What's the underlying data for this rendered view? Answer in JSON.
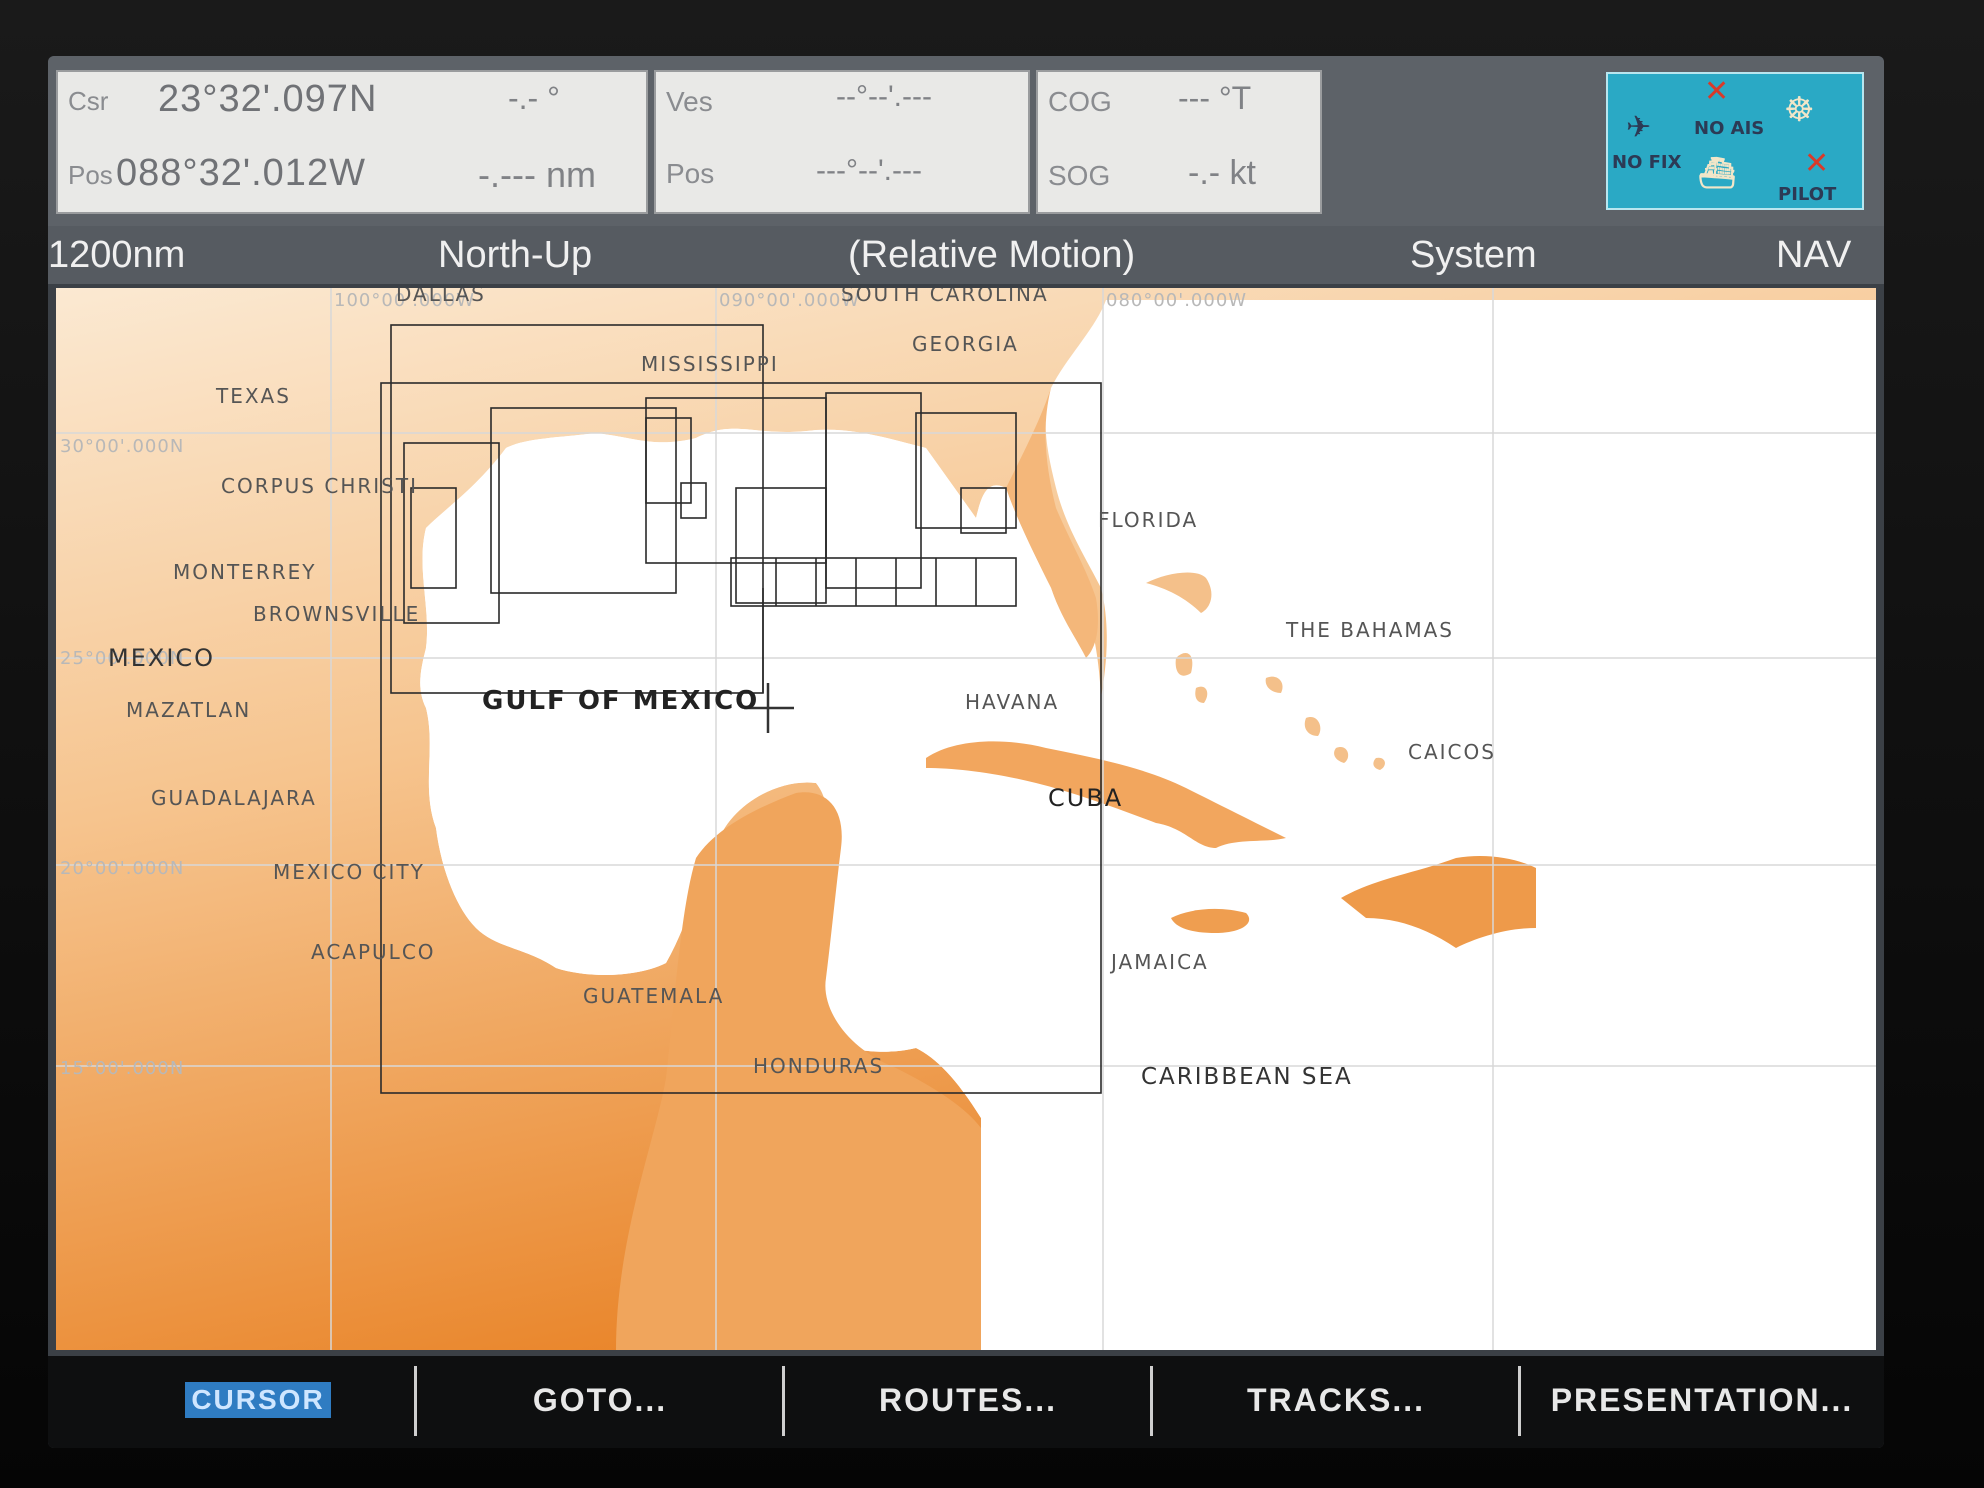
{
  "data_boxes": {
    "box1": {
      "csr_label": "Csr",
      "lat": "23°32'.097N",
      "csr_value": "-.- °",
      "pos_label": "Pos",
      "lon": "088°32'.012W",
      "dist_value": "-.--- nm"
    },
    "box2": {
      "ves_label": "Ves",
      "ves_value": "--°--'.---",
      "pos_label": "Pos",
      "pos_value": "---°--'.---"
    },
    "box3": {
      "cog_label": "COG",
      "cog_value": "--- °T",
      "sog_label": "SOG",
      "sog_value": "-.- kt"
    }
  },
  "status_panel": {
    "no_ais": "NO AIS",
    "no_fix": "NO FIX",
    "pilot": "PILOT"
  },
  "mode_bar": {
    "range": "1200nm",
    "orientation": "North-Up",
    "motion": "(Relative Motion)",
    "menu": "System",
    "mode": "NAV"
  },
  "map": {
    "grid_labels": {
      "lon_100": "100°00'.000W",
      "lon_090": "090°00'.000W",
      "lon_080": "080°00'.000W",
      "lat_30": "30°00'.000N",
      "lat_25": "25°00'.000N",
      "lat_20": "20°00'.000N",
      "lat_15": "15°00'.000N"
    },
    "places": {
      "dallas": "DALLAS",
      "south_carolina": "SOUTH CAROLINA",
      "georgia": "GEORGIA",
      "mississippi": "MISSISSIPPI",
      "texas": "TEXAS",
      "corpus_christi": "CORPUS CHRISTI",
      "monterrey": "MONTERREY",
      "brownsville": "BROWNSVILLE",
      "mexico": "MEXICO",
      "mazatlan": "MAZATLAN",
      "guadalajara": "GUADALAJARA",
      "mexico_city": "MEXICO CITY",
      "acapulco": "ACAPULCO",
      "guatemala": "GUATEMALA",
      "honduras": "HONDURAS",
      "gulf_of_mexico": "GULF OF MEXICO",
      "havana": "HAVANA",
      "cuba": "CUBA",
      "florida": "FLORIDA",
      "the_bahamas": "THE BAHAMAS",
      "caicos": "CAICOS",
      "jamaica": "JAMAICA",
      "caribbean_sea": "CARIBBEAN SEA"
    }
  },
  "softkeys": {
    "cursor": "CURSOR",
    "goto": "GOTO...",
    "routes": "ROUTES...",
    "tracks": "TRACKS...",
    "presentation": "PRESENTATION..."
  },
  "colors": {
    "land_light": "#fbe4c4",
    "land_dark": "#ec8b2e",
    "water": "#ffffff",
    "status_panel": "#2aa9c5"
  }
}
